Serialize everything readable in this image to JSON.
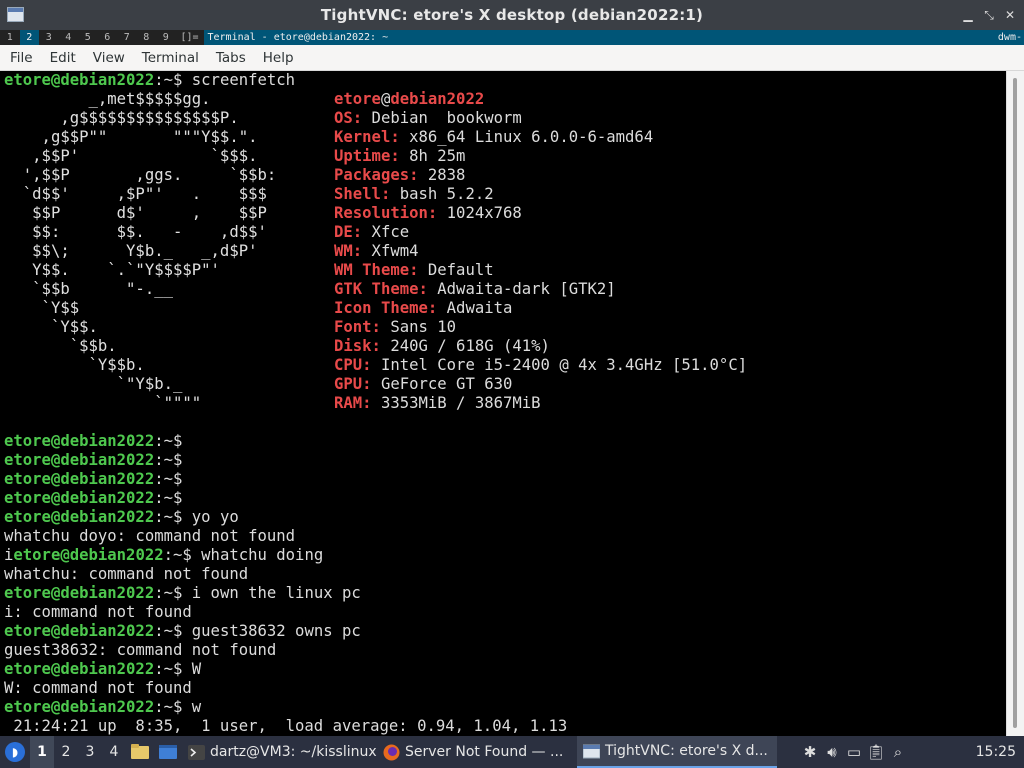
{
  "window": {
    "title": "TightVNC: etore's X desktop (debian2022:1)",
    "app_icon": "tightvnc-icon",
    "controls": [
      "minimize-icon",
      "maximize-icon",
      "close-icon"
    ]
  },
  "dwm": {
    "tags": [
      "1",
      "2",
      "3",
      "4",
      "5",
      "6",
      "7",
      "8",
      "9"
    ],
    "selected_tag": "2",
    "layout": "[]=",
    "window_title": "Terminal - etore@debian2022: ~",
    "status": "dwm-"
  },
  "menu": [
    "File",
    "Edit",
    "View",
    "Terminal",
    "Tabs",
    "Help"
  ],
  "terminal": {
    "prompt_user": "etore@debian2022",
    "prompt_suffix": ":~$",
    "first_command": "screenfetch",
    "logo_lines": [
      "         _,met$$$$$gg.",
      "      ,g$$$$$$$$$$$$$$$P.",
      "    ,g$$P\"\"       \"\"\"Y$$.\".",
      "   ,$$P'              `$$$.",
      "  ',$$P       ,ggs.     `$$b:",
      "  `d$$'     ,$P\"'   .    $$$",
      "   $$P      d$'     ,    $$P",
      "   $$:      $$.   -    ,d$$'",
      "   $$\\;      Y$b._   _,d$P'",
      "   Y$$.    `.`\"Y$$$$P\"'",
      "   `$$b      \"-.__",
      "    `Y$$",
      "     `Y$$.",
      "       `$$b.",
      "         `Y$$b.",
      "            `\"Y$b._",
      "                `\"\"\"\""
    ],
    "sysinfo": {
      "user": "etore",
      "host": "debian2022",
      "fields": [
        {
          "key": "OS:",
          "value": " Debian  bookworm"
        },
        {
          "key": "Kernel:",
          "value": " x86_64 Linux 6.0.0-6-amd64"
        },
        {
          "key": "Uptime:",
          "value": " 8h 25m"
        },
        {
          "key": "Packages:",
          "value": " 2838"
        },
        {
          "key": "Shell:",
          "value": " bash 5.2.2"
        },
        {
          "key": "Resolution:",
          "value": " 1024x768"
        },
        {
          "key": "DE:",
          "value": " Xfce"
        },
        {
          "key": "WM:",
          "value": " Xfwm4"
        },
        {
          "key": "WM Theme:",
          "value": " Default"
        },
        {
          "key": "GTK Theme:",
          "value": " Adwaita-dark [GTK2]"
        },
        {
          "key": "Icon Theme:",
          "value": " Adwaita"
        },
        {
          "key": "Font:",
          "value": " Sans 10"
        },
        {
          "key": "Disk:",
          "value": " 240G / 618G (41%)"
        },
        {
          "key": "CPU:",
          "value": " Intel Core i5-2400 @ 4x 3.4GHz [51.0°C]"
        },
        {
          "key": "GPU:",
          "value": " GeForce GT 630"
        },
        {
          "key": "RAM:",
          "value": " 3353MiB / 3867MiB"
        }
      ]
    },
    "lines": [
      {
        "pre": "",
        "user": "etore@debian2022",
        "cmd": ""
      },
      {
        "pre": "",
        "user": "etore@debian2022",
        "cmd": ""
      },
      {
        "pre": "",
        "user": "etore@debian2022",
        "cmd": ""
      },
      {
        "pre": "",
        "user": "etore@debian2022",
        "cmd": ""
      },
      {
        "pre": "",
        "user": "etore@debian2022",
        "cmd": " yo yo"
      },
      {
        "text": "whatchu doyo: command not found"
      },
      {
        "pre": "i",
        "user": "etore@debian2022",
        "cmd": " whatchu doing"
      },
      {
        "text": "whatchu: command not found"
      },
      {
        "pre": "",
        "user": "etore@debian2022",
        "cmd": " i own the linux pc"
      },
      {
        "text": "i: command not found"
      },
      {
        "pre": "",
        "user": "etore@debian2022",
        "cmd": " guest38632 owns pc"
      },
      {
        "text": "guest38632: command not found"
      },
      {
        "pre": "",
        "user": "etore@debian2022",
        "cmd": " W"
      },
      {
        "text": "W: command not found"
      },
      {
        "pre": "",
        "user": "etore@debian2022",
        "cmd": " w"
      },
      {
        "text": " 21:24:21 up  8:35,  1 user,  load average: 0.94, 1.04, 1.13"
      }
    ]
  },
  "taskbar": {
    "workspaces": [
      "1",
      "2",
      "3",
      "4"
    ],
    "active_workspace": "1",
    "tasks": [
      {
        "icon": "terminal-icon",
        "label": "dartz@VM3: ~/kisslinux"
      },
      {
        "icon": "firefox-icon",
        "label": "Server Not Found — ..."
      },
      {
        "icon": "tightvnc-icon",
        "label": "TightVNC: etore's X d..."
      }
    ],
    "clock": "15:25"
  },
  "colors": {
    "prompt": "#4ec84e",
    "sysinfo_key": "#e84a4a",
    "logo_red": "#d12b2b",
    "titlebar": "#3b3f45",
    "dwm_selected": "#005577",
    "taskbar": "#2b3040"
  }
}
